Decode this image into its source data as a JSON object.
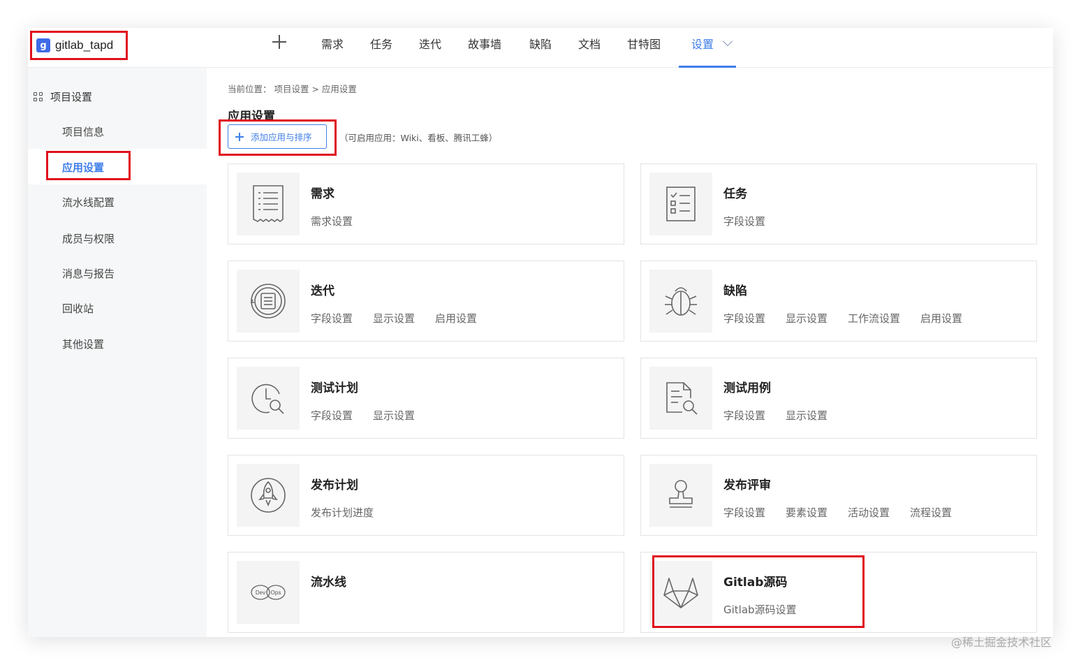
{
  "project": {
    "logo_letter": "g",
    "name": "gitlab_tapd"
  },
  "nav": {
    "items": [
      "需求",
      "任务",
      "迭代",
      "故事墙",
      "缺陷",
      "文档",
      "甘特图",
      "设置"
    ],
    "active": "设置"
  },
  "sidebar": {
    "title": "项目设置",
    "items": [
      "项目信息",
      "应用设置",
      "流水线配置",
      "成员与权限",
      "消息与报告",
      "回收站",
      "其他设置"
    ],
    "active": "应用设置"
  },
  "main": {
    "breadcrumb": "当前位置： 项目设置 > 应用设置",
    "title": "应用设置",
    "add_button": "添加应用与排序",
    "hint": "（可启用应用：Wiki、看板、腾讯工蜂）",
    "cards": [
      {
        "title": "需求",
        "icon": "document-lines-icon",
        "links": [
          "需求设置"
        ]
      },
      {
        "title": "任务",
        "icon": "checklist-icon",
        "links": [
          "字段设置"
        ]
      },
      {
        "title": "迭代",
        "icon": "iteration-icon",
        "links": [
          "字段设置",
          "显示设置",
          "启用设置"
        ]
      },
      {
        "title": "缺陷",
        "icon": "bug-icon",
        "links": [
          "字段设置",
          "显示设置",
          "工作流设置",
          "启用设置"
        ]
      },
      {
        "title": "测试计划",
        "icon": "clock-search-icon",
        "links": [
          "字段设置",
          "显示设置"
        ]
      },
      {
        "title": "测试用例",
        "icon": "file-search-icon",
        "links": [
          "字段设置",
          "显示设置"
        ]
      },
      {
        "title": "发布计划",
        "icon": "rocket-icon",
        "links": [
          "发布计划进度"
        ]
      },
      {
        "title": "发布评审",
        "icon": "stamp-icon",
        "links": [
          "字段设置",
          "要素设置",
          "活动设置",
          "流程设置"
        ]
      },
      {
        "title": "流水线",
        "icon": "devops-icon",
        "links": []
      },
      {
        "title": "Gitlab源码",
        "icon": "gitlab-icon",
        "links": [
          "Gitlab源码设置"
        ]
      }
    ]
  },
  "devops_labels": [
    "Dev",
    "Ops"
  ],
  "watermark": "@稀土掘金技术社区",
  "colors": {
    "accent": "#3f7ee8",
    "highlight": "#e0101d",
    "logo": "#3f6be8"
  }
}
